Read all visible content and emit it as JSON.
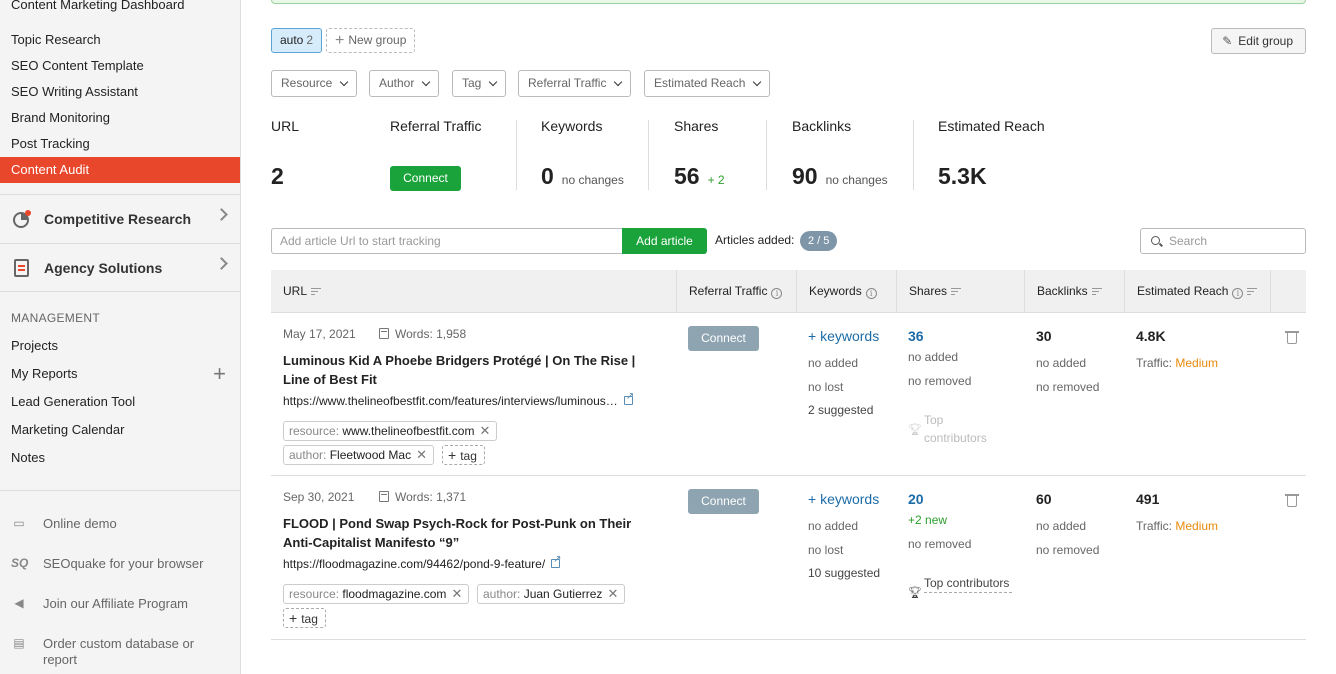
{
  "sidebar": {
    "top_items": [
      {
        "label": "Content Marketing Dashboard"
      },
      {
        "label": "Topic Research"
      },
      {
        "label": "SEO Content Template"
      },
      {
        "label": "SEO Writing Assistant"
      },
      {
        "label": "Brand Monitoring"
      },
      {
        "label": "Post Tracking"
      },
      {
        "label": "Content Audit"
      }
    ],
    "sections": [
      {
        "label": "Competitive Research",
        "icon": "pie-chart-icon"
      },
      {
        "label": "Agency Solutions",
        "icon": "document-icon"
      }
    ],
    "management_heading": "MANAGEMENT",
    "management_items": [
      {
        "label": "Projects"
      },
      {
        "label": "My Reports"
      },
      {
        "label": "Lead Generation Tool"
      },
      {
        "label": "Marketing Calendar"
      },
      {
        "label": "Notes"
      }
    ],
    "footer_items": [
      {
        "label": "Online demo",
        "icon": "monitor-icon"
      },
      {
        "label": "SEOquake for your browser",
        "icon": "seoquake-icon"
      },
      {
        "label": "Join our Affiliate Program",
        "icon": "megaphone-icon"
      },
      {
        "label": "Order custom database or report",
        "icon": "clipboard-icon"
      }
    ],
    "colors": {
      "active": "#e8472b"
    }
  },
  "toolbar": {
    "group_tab_label": "auto",
    "group_tab_count": "2",
    "new_group_label": "New group",
    "edit_group_label": "Edit group"
  },
  "filters": [
    "Resource",
    "Author",
    "Tag",
    "Referral Traffic",
    "Estimated Reach"
  ],
  "metrics": {
    "url": {
      "label": "URL",
      "value": "2"
    },
    "referral": {
      "label": "Referral Traffic",
      "button": "Connect"
    },
    "keywords": {
      "label": "Keywords",
      "value": "0",
      "sub": "no changes"
    },
    "shares": {
      "label": "Shares",
      "value": "56",
      "sub": "+ 2"
    },
    "backlinks": {
      "label": "Backlinks",
      "value": "90",
      "sub": "no changes"
    },
    "reach": {
      "label": "Estimated Reach",
      "value": "5.3K"
    }
  },
  "add_article": {
    "placeholder": "Add article Url to start tracking",
    "button": "Add article",
    "articles_added_label": "Articles added:",
    "articles_added_value": "2 / 5",
    "search_placeholder": "Search"
  },
  "table": {
    "headers": [
      "URL",
      "Referral Traffic",
      "Keywords",
      "Shares",
      "Backlinks",
      "Estimated Reach"
    ],
    "rows": [
      {
        "date": "May 17, 2021",
        "words": "Words: 1,958",
        "title": "Luminous Kid A Phoebe Bridgers Protégé | On The Rise | Line of Best Fit",
        "url": "https://www.thelineofbestfit.com/features/interviews/luminous…",
        "resource_key": "resource:",
        "resource_val": "www.thelineofbestfit.com",
        "author_key": "author:",
        "author_val": "Fleetwood Mac",
        "tag_label": "tag",
        "connect": "Connect",
        "kw_link": "+ keywords",
        "kw_added": "no added",
        "kw_lost": "no lost",
        "kw_suggested": "2 suggested",
        "shares": "36",
        "shares_added": "no added",
        "shares_removed": "no removed",
        "contrib": "Top contributors",
        "backlinks": "30",
        "bl_added": "no added",
        "bl_removed": "no removed",
        "reach": "4.8K",
        "traffic_label": "Traffic:",
        "traffic_level": "Medium"
      },
      {
        "date": "Sep 30, 2021",
        "words": "Words: 1,371",
        "title": "FLOOD | Pond Swap Psych-Rock for Post-Punk on Their Anti-Capitalist Manifesto “9”",
        "url": "https://floodmagazine.com/94462/pond-9-feature/",
        "resource_key": "resource:",
        "resource_val": "floodmagazine.com",
        "author_key": "author:",
        "author_val": "Juan Gutierrez",
        "tag_label": "tag",
        "connect": "Connect",
        "kw_link": "+ keywords",
        "kw_added": "no added",
        "kw_lost": "no lost",
        "kw_suggested": "10 suggested",
        "shares": "20",
        "shares_new": "+2 new",
        "shares_removed": "no removed",
        "contrib": "Top contributors",
        "backlinks": "60",
        "bl_added": "no added",
        "bl_removed": "no removed",
        "reach": "491",
        "traffic_label": "Traffic:",
        "traffic_level": "Medium"
      }
    ]
  }
}
